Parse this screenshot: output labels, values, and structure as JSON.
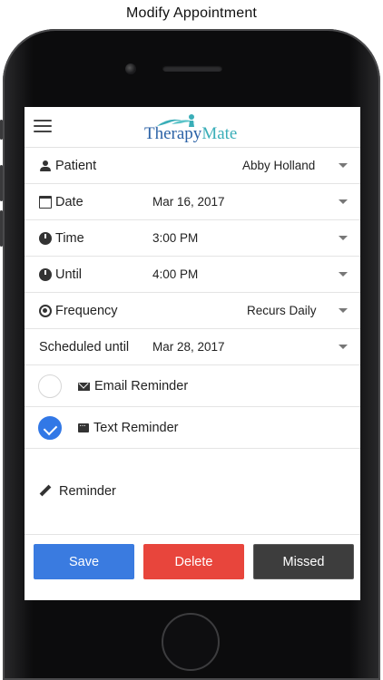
{
  "window": {
    "title": "Modify Appointment"
  },
  "app": {
    "logo_part1": "Therapy",
    "logo_part2": "Mate"
  },
  "form": {
    "patient": {
      "label": "Patient",
      "value": "Abby Holland",
      "icon": "person-icon"
    },
    "date": {
      "label": "Date",
      "value": "Mar 16, 2017",
      "icon": "calendar-icon"
    },
    "time": {
      "label": "Time",
      "value": "3:00 PM",
      "icon": "clock-icon"
    },
    "until": {
      "label": "Until",
      "value": "4:00 PM",
      "icon": "clock-icon"
    },
    "frequency": {
      "label": "Frequency",
      "value": "Recurs Daily",
      "icon": "sync-icon"
    },
    "scheduled_until": {
      "label": "Scheduled until",
      "value": "Mar 28, 2017"
    },
    "email_reminder": {
      "label": "Email Reminder",
      "checked": false,
      "icon": "mail-icon"
    },
    "text_reminder": {
      "label": "Text Reminder",
      "checked": true,
      "icon": "sms-icon"
    },
    "reminder": {
      "label": "Reminder",
      "icon": "pencil-icon"
    }
  },
  "buttons": {
    "save": "Save",
    "delete": "Delete",
    "missed": "Missed"
  },
  "colors": {
    "save": "#3a7be0",
    "delete": "#e8453c",
    "missed": "#3d3d3d",
    "check": "#3278e6"
  }
}
